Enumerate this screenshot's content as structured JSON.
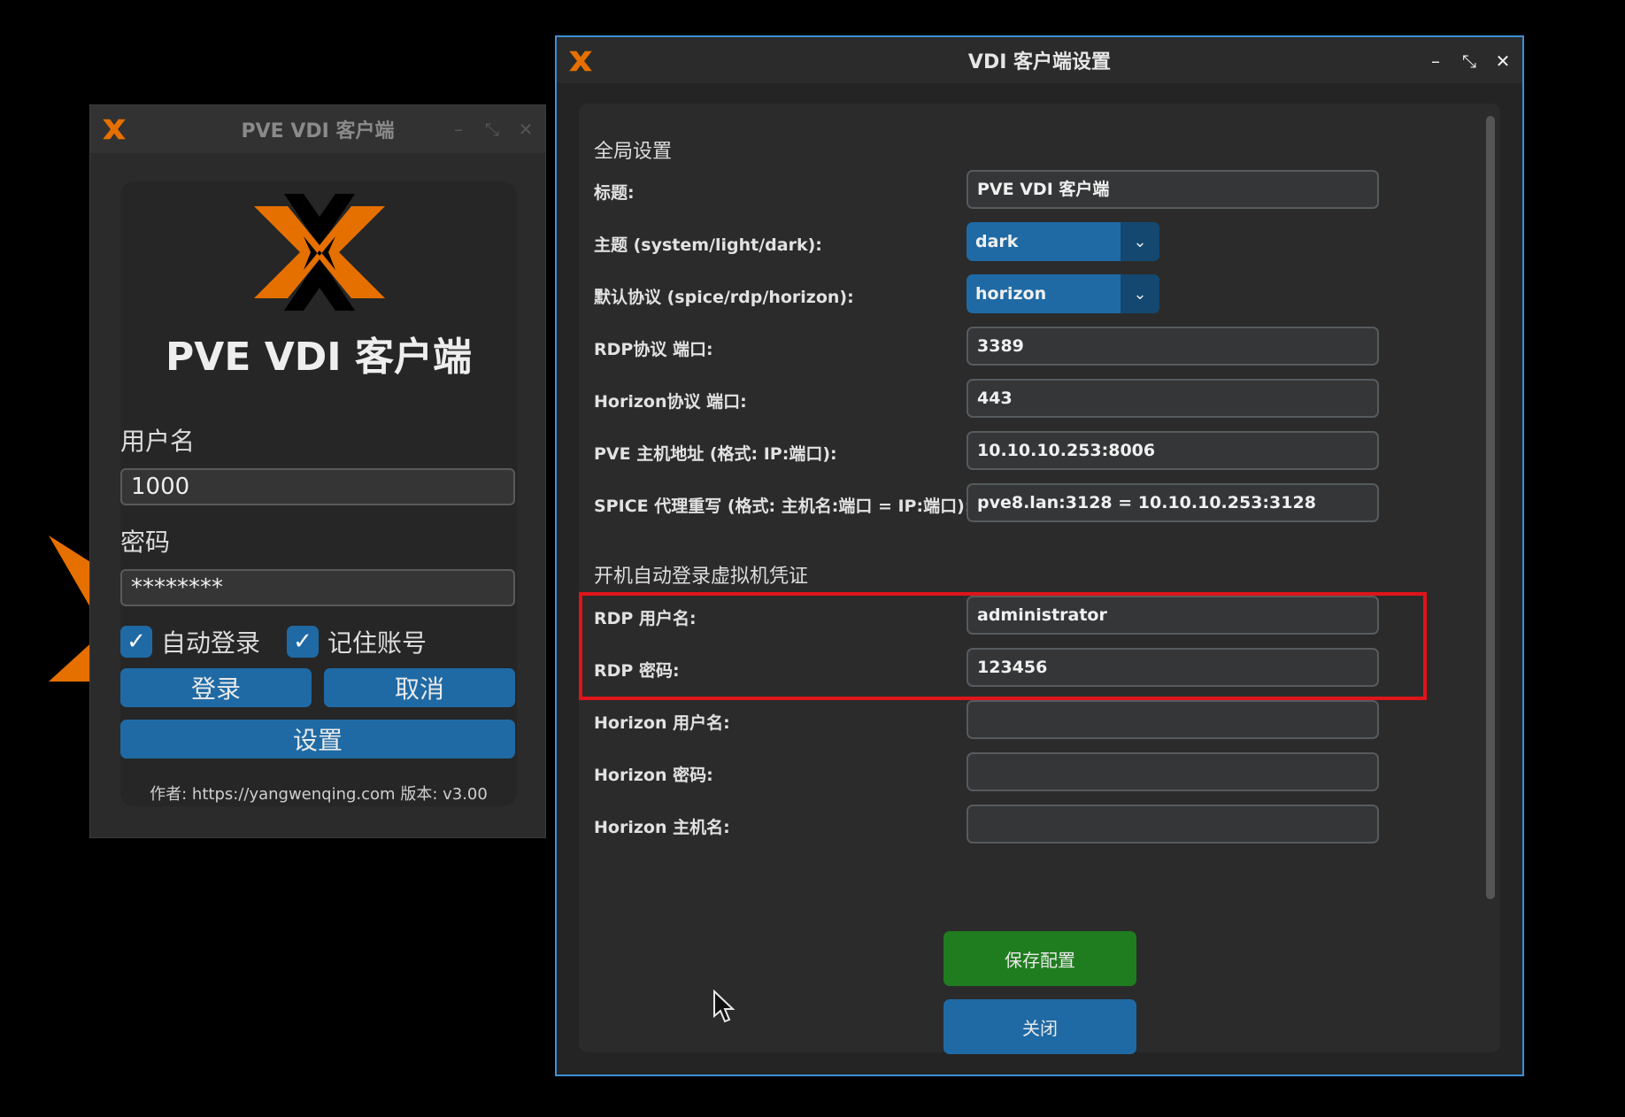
{
  "login_window": {
    "title": "PVE VDI 客户端",
    "heading": "PVE VDI 客户端",
    "username_label": "用户名",
    "username_value": "1000",
    "password_label": "密码",
    "password_value": "********",
    "auto_login_label": "自动登录",
    "remember_label": "记住账号",
    "login_button": "登录",
    "cancel_button": "取消",
    "settings_button": "设置",
    "author_text": "作者: https://yangwenqing.com  版本: v3.00"
  },
  "settings_window": {
    "title": "VDI 客户端设置",
    "global_section": "全局设置",
    "title_label": "标题:",
    "title_value": "PVE VDI 客户端",
    "theme_label": "主题 (system/light/dark):",
    "theme_value": "dark",
    "protocol_label": "默认协议 (spice/rdp/horizon):",
    "protocol_value": "horizon",
    "rdp_port_label": "RDP协议 端口:",
    "rdp_port_value": "3389",
    "horizon_port_label": "Horizon协议 端口:",
    "horizon_port_value": "443",
    "pve_host_label": "PVE 主机地址 (格式: IP:端口):",
    "pve_host_value": "10.10.10.253:8006",
    "spice_proxy_label": "SPICE 代理重写 (格式: 主机名:端口 = IP:端口):",
    "spice_proxy_value": "pve8.lan:3128 = 10.10.10.253:3128",
    "autologin_section": "开机自动登录虚拟机凭证",
    "rdp_user_label": "RDP 用户名:",
    "rdp_user_value": "administrator",
    "rdp_pass_label": "RDP 密码:",
    "rdp_pass_value": "123456",
    "horizon_user_label": "Horizon 用户名:",
    "horizon_user_value": "",
    "horizon_pass_label": "Horizon 密码:",
    "horizon_pass_value": "",
    "horizon_host_label": "Horizon 主机名:",
    "horizon_host_value": "",
    "save_button": "保存配置",
    "close_button": "关闭"
  },
  "titlebar_buttons": {
    "minimize": "–",
    "restore": "⤡",
    "close": "✕"
  },
  "colors": {
    "accent_blue": "#1f6aa5",
    "save_green": "#1f7d1f",
    "logo_orange": "#e57000",
    "highlight_red": "#e0141b",
    "active_border": "#3f8fd8"
  }
}
